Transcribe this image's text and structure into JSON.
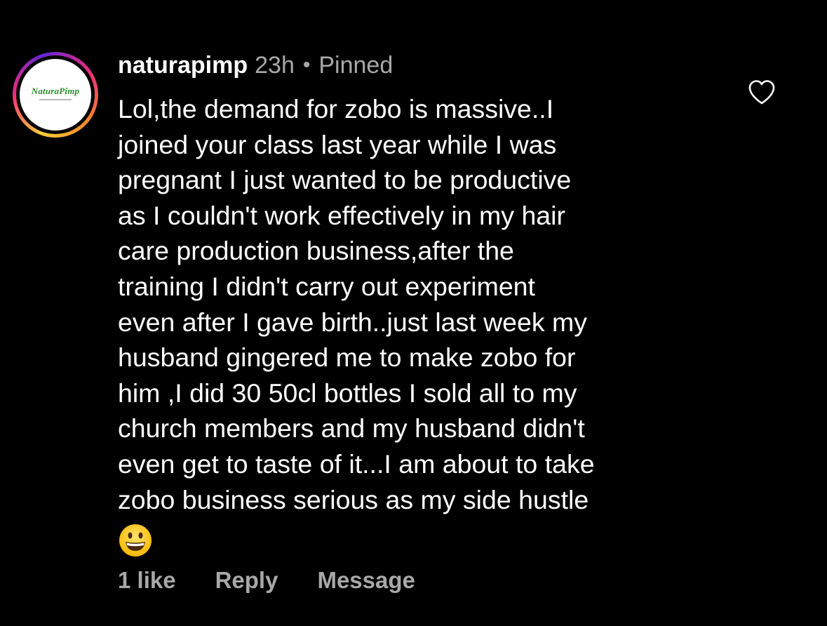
{
  "comment": {
    "username": "naturapimp",
    "time": "23h",
    "separator": "•",
    "pinned_label": "Pinned",
    "avatar": {
      "logo_text": "NaturaPimp",
      "ring_colors": [
        "#f9ce34",
        "#ee2a7b",
        "#6228d7",
        "#f58529"
      ]
    },
    "text_lines": [
      "Lol,the demand for zobo is massive..I",
      "joined your class last year while I was",
      "pregnant I just wanted to be productive",
      "as I couldn't work effectively in my hair",
      "care production business,after the",
      "training I didn't carry out experiment",
      "even after I gave birth..just last week my",
      "husband gingered me to make zobo for",
      "him ,I did 30 50cl bottles I sold all to my",
      "church members and my husband didn't",
      "even get to taste of it...I am about to take",
      "zobo business serious as my side hustle"
    ],
    "emoji": "grinning-face-emoji",
    "actions": {
      "likes": "1 like",
      "reply": "Reply",
      "message": "Message"
    },
    "like_icon": "heart-outline-icon"
  },
  "colors": {
    "background": "#000000",
    "primary_text": "#ffffff",
    "secondary_text": "#a8a8a8"
  }
}
